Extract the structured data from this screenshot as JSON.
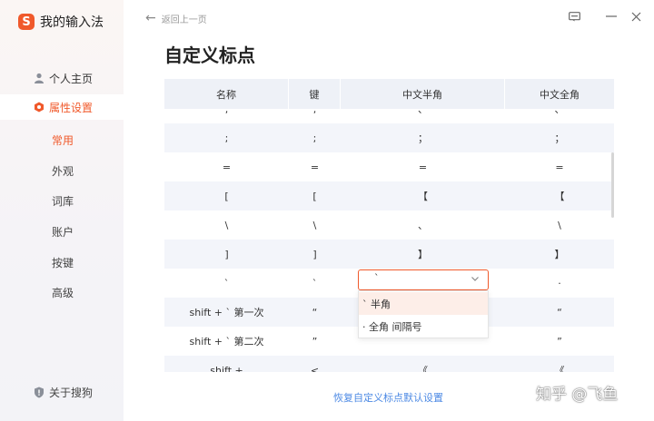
{
  "app": {
    "name": "我的输入法",
    "logo_glyph": "S",
    "accent": "#f0592b"
  },
  "sidebar": {
    "items": [
      {
        "label": "个人主页",
        "icon": "user-icon"
      },
      {
        "label": "属性设置",
        "icon": "settings-hexagon-icon"
      }
    ],
    "sub_items": [
      "常用",
      "外观",
      "词库",
      "账户",
      "按键",
      "高级"
    ],
    "about": {
      "label": "关于搜狗",
      "icon": "shield-icon"
    }
  },
  "header": {
    "back_label": "返回上一页",
    "title": "自定义标点"
  },
  "table": {
    "headers": [
      "名称",
      "键",
      "中文半角",
      "中文全角"
    ],
    "rows": [
      [
        ";",
        ";",
        "；",
        "；"
      ],
      [
        "=",
        "=",
        "=",
        "="
      ],
      [
        "[",
        "[",
        "【",
        "【"
      ],
      [
        "\\",
        "\\",
        "、",
        "\\"
      ],
      [
        "]",
        "]",
        "】",
        "】"
      ],
      [
        "`",
        "`",
        "",
        "·"
      ],
      [
        "shift + ` 第一次",
        "“",
        "",
        "“"
      ],
      [
        "shift + ` 第二次",
        "”",
        "",
        "”"
      ],
      [
        "shift +",
        "<",
        "《",
        "《"
      ]
    ],
    "partial_top_row": [
      ",",
      ",",
      "、",
      "、"
    ]
  },
  "dropdown": {
    "selected_value": "`",
    "options": [
      {
        "label": "` 半角",
        "selected": true
      },
      {
        "label": "· 全角 间隔号",
        "selected": false
      }
    ]
  },
  "footer": {
    "reset_link": "恢复自定义标点默认设置"
  },
  "watermark": "知乎 @飞鱼"
}
